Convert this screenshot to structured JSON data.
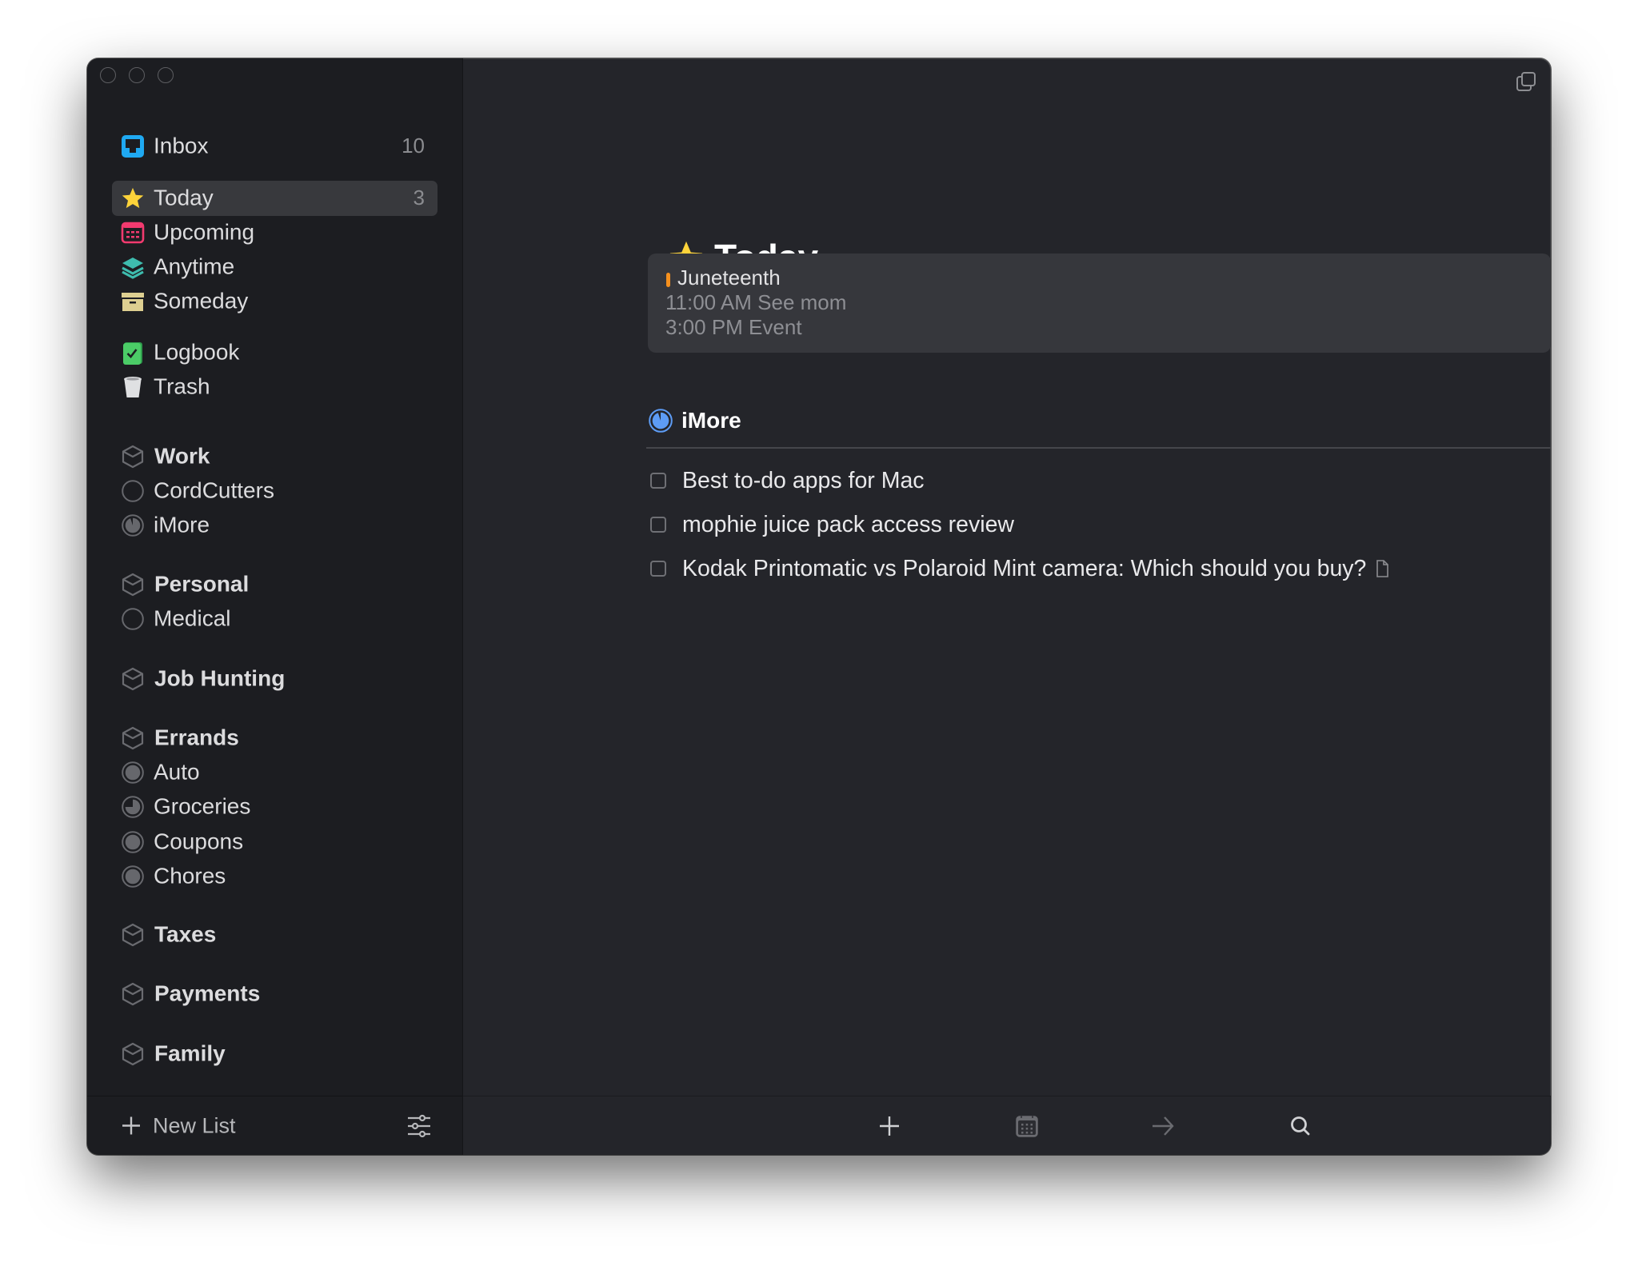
{
  "window": {
    "traffic_lights": [
      "close",
      "minimize",
      "zoom"
    ]
  },
  "sidebar": {
    "items": [
      {
        "label": "Inbox",
        "count": "10",
        "icon": "inbox-icon",
        "type": "builtin"
      },
      {
        "label": "Today",
        "count": "3",
        "icon": "star-icon",
        "type": "builtin",
        "selected": true
      },
      {
        "label": "Upcoming",
        "icon": "calendar-icon",
        "type": "builtin"
      },
      {
        "label": "Anytime",
        "icon": "layers-icon",
        "type": "builtin"
      },
      {
        "label": "Someday",
        "icon": "archive-box-icon",
        "type": "builtin"
      },
      {
        "label": "Logbook",
        "icon": "logbook-icon",
        "type": "builtin"
      },
      {
        "label": "Trash",
        "icon": "trash-icon",
        "type": "builtin"
      },
      {
        "label": "Work",
        "icon": "area-cube-icon",
        "type": "area"
      },
      {
        "label": "CordCutters",
        "icon": "project-progress-icon",
        "type": "project",
        "progress": 0
      },
      {
        "label": "iMore",
        "icon": "project-progress-icon",
        "type": "project",
        "progress": 0.95
      },
      {
        "label": "Personal",
        "icon": "area-cube-icon",
        "type": "area"
      },
      {
        "label": "Medical",
        "icon": "project-progress-icon",
        "type": "project",
        "progress": 0
      },
      {
        "label": "Job Hunting",
        "icon": "area-cube-icon",
        "type": "area"
      },
      {
        "label": "Errands",
        "icon": "area-cube-icon",
        "type": "area"
      },
      {
        "label": "Auto",
        "icon": "project-progress-icon",
        "type": "project",
        "progress": 1.0
      },
      {
        "label": "Groceries",
        "icon": "project-progress-icon",
        "type": "project",
        "progress": 0.75
      },
      {
        "label": "Coupons",
        "icon": "project-progress-icon",
        "type": "project",
        "progress": 1.0
      },
      {
        "label": "Chores",
        "icon": "project-progress-icon",
        "type": "project",
        "progress": 1.0
      },
      {
        "label": "Taxes",
        "icon": "area-cube-icon",
        "type": "area"
      },
      {
        "label": "Payments",
        "icon": "area-cube-icon",
        "type": "area"
      },
      {
        "label": "Family",
        "icon": "area-cube-icon",
        "type": "area"
      }
    ],
    "new_list_label": "New List"
  },
  "main": {
    "title": "Today",
    "calendar_events": {
      "all_day": "Juneteenth",
      "events": [
        "11:00 AM See mom",
        "3:00 PM Event"
      ]
    },
    "project": {
      "name": "iMore",
      "progress": 0.95,
      "tasks": [
        {
          "title": "Best to-do apps for Mac",
          "done": false,
          "has_note": false
        },
        {
          "title": "mophie juice pack access review",
          "done": false,
          "has_note": false
        },
        {
          "title": "Kodak Printomatic vs Polaroid Mint camera: Which should you buy?",
          "done": false,
          "has_note": true
        }
      ]
    },
    "toolbar": [
      "add-task",
      "schedule",
      "move",
      "search"
    ]
  },
  "colors": {
    "sidebar_bg": "#1c1d21",
    "main_bg": "#24252a",
    "selected_bg": "#38393d",
    "inbox_blue": "#1fa9f2",
    "today_yellow": "#fdd33a",
    "upcoming_pink": "#f23a6f",
    "anytime_teal": "#3ebcae",
    "someday_tan": "#ddcf91",
    "logbook_green": "#4bcc67",
    "project_blue": "#5d9cf5",
    "event_orange": "#f5901e"
  }
}
